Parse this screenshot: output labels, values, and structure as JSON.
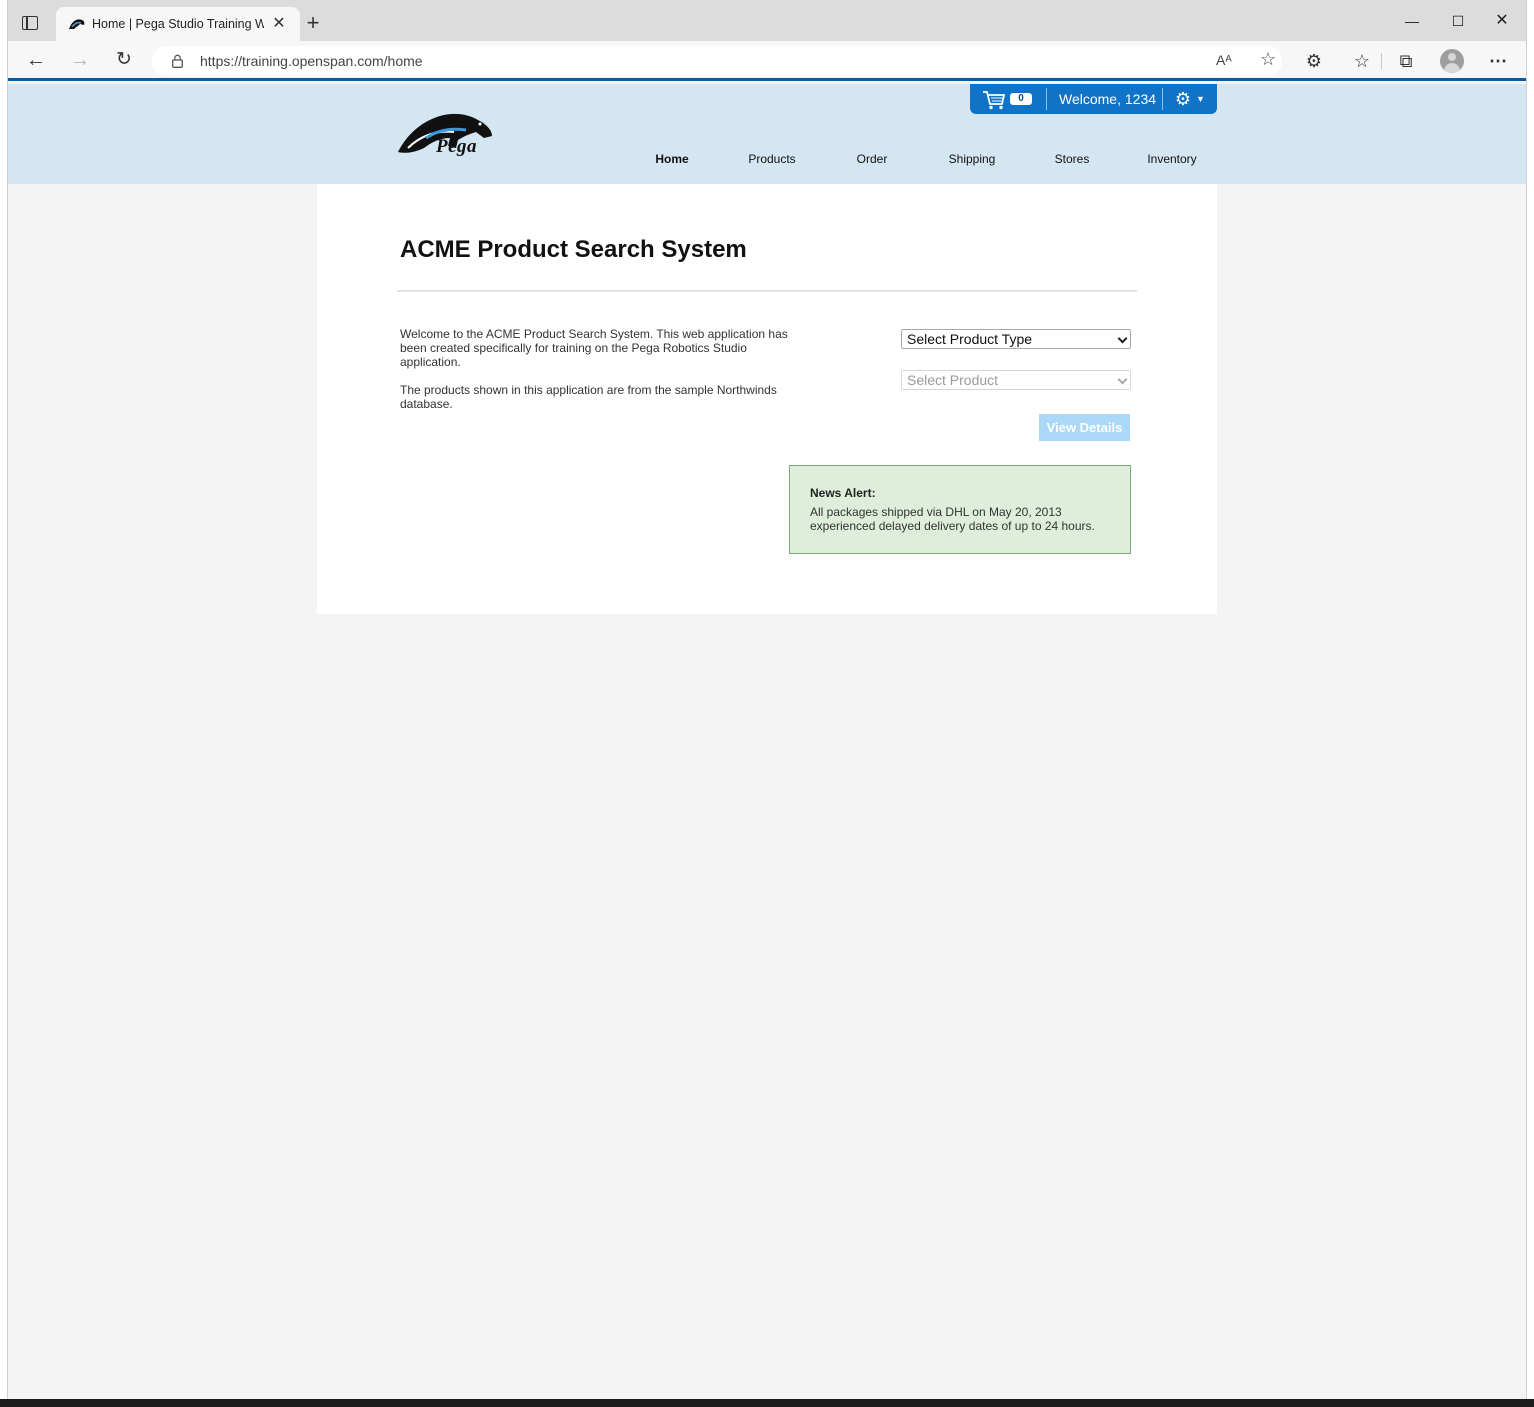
{
  "browser": {
    "tab_title": "Home | Pega Studio Training Wel",
    "url": "https://training.openspan.com/home",
    "read_aloud_label": "Aᴬ"
  },
  "header": {
    "logo_text": "Pega",
    "cart_count": "0",
    "welcome_text": "Welcome, 1234",
    "nav": [
      {
        "label": "Home",
        "active": true
      },
      {
        "label": "Products"
      },
      {
        "label": "Order"
      },
      {
        "label": "Shipping"
      },
      {
        "label": "Stores"
      },
      {
        "label": "Inventory"
      }
    ],
    "colors": {
      "header_bg": "#d5e6f3",
      "user_bar": "#0f74c8"
    }
  },
  "main": {
    "title": "ACME Product Search System",
    "intro_1": "Welcome to the ACME Product Search System. This web application has been created specifically for training on the Pega Robotics Studio application.",
    "intro_2": "The products shown in this application are from the sample Northwinds database.",
    "product_type_select": "Select Product Type",
    "product_select": "Select Product",
    "view_details_label": "View Details",
    "news_alert": {
      "title": "News Alert:",
      "body": "All packages shipped via DHL on May 20, 2013 experienced delayed delivery dates of up to 24 hours."
    }
  }
}
